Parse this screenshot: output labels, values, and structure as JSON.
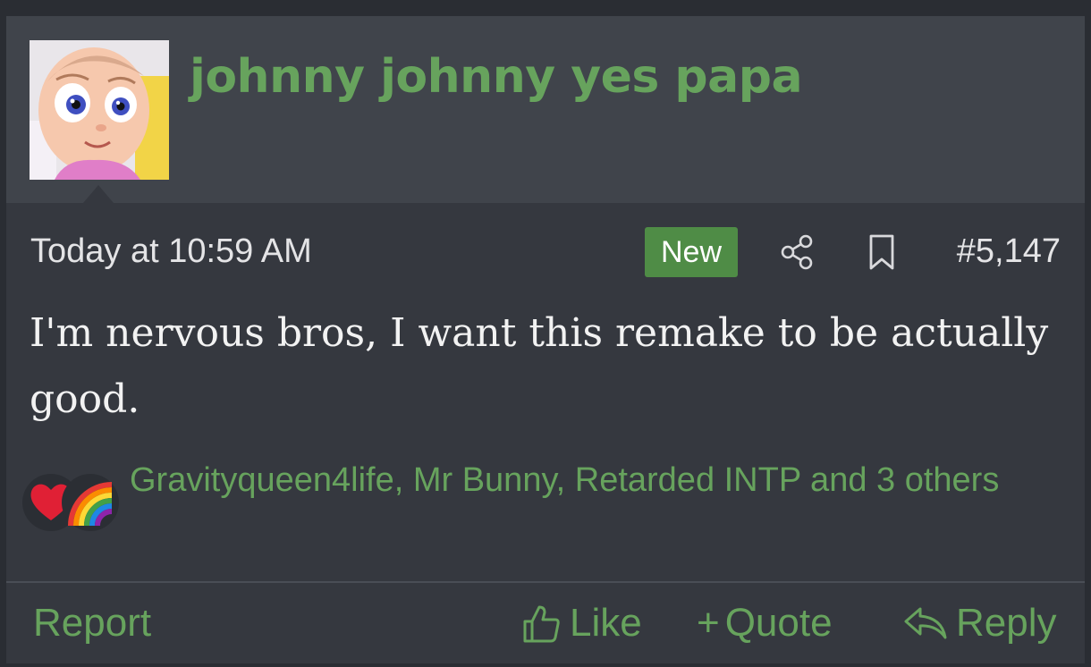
{
  "post": {
    "username": "johnny johnny yes papa",
    "timestamp": "Today at 10:59 AM",
    "badge": "New",
    "post_number": "#5,147",
    "message": "I'm nervous bros, I want this remake to be actually good.",
    "reactions": {
      "icons": [
        "heart-emoji",
        "rainbow-emoji"
      ],
      "text": "Gravityqueen4life, Mr Bunny, Retarded INTP and 3 others"
    }
  },
  "footer": {
    "report_label": "Report",
    "like_label": "Like",
    "quote_plus": "+",
    "quote_label": "Quote",
    "reply_label": "Reply"
  },
  "colors": {
    "accent_green": "#67a35d",
    "badge_green": "#4f8c46",
    "header_bg": "#40444b",
    "body_bg": "#35383f",
    "text_light": "#e4e4e6"
  },
  "icons": {
    "share": "share-icon",
    "bookmark": "bookmark-icon",
    "like": "thumbs-up-icon",
    "reply": "reply-arrow-icon"
  }
}
